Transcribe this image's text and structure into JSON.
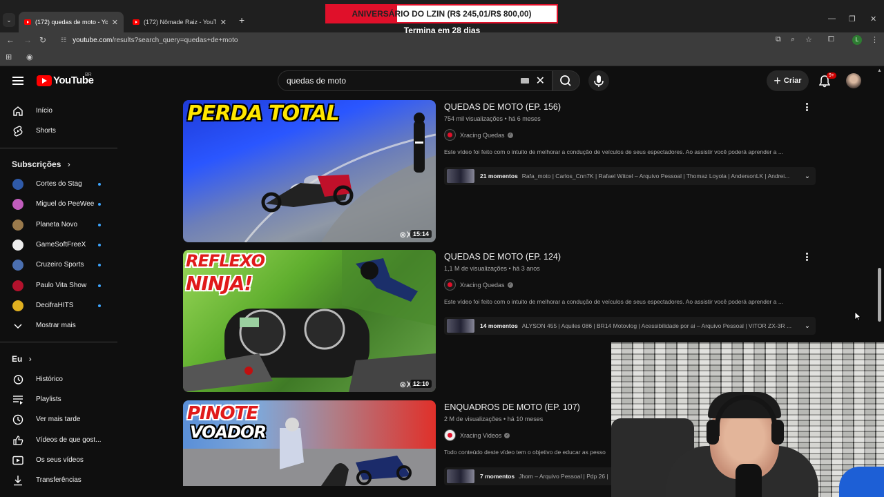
{
  "browser": {
    "tabs": [
      {
        "title": "(172) quedas de moto - YouTube",
        "active": true
      },
      {
        "title": "(172) Nômade Raiz - YouTube",
        "active": false
      }
    ],
    "url_host": "youtube.com",
    "url_path": "/results?search_query=quedas+de+moto",
    "profile_letter": "L"
  },
  "overlay": {
    "goal_text": "ANIVERSÁRIO DO LZIN (R$ 245,01/R$ 800,00)",
    "goal_progress_percent": 30.6,
    "countdown": "Termina em 28 dias",
    "fill_color": "#e0102a"
  },
  "header": {
    "logo": "YouTube",
    "country": "BR",
    "search_value": "quedas de moto",
    "create_label": "Criar",
    "notif_badge": "9+"
  },
  "sidebar": {
    "main": [
      {
        "label": "Início",
        "icon": "home-icon"
      },
      {
        "label": "Shorts",
        "icon": "shorts-icon"
      }
    ],
    "subscriptions_title": "Subscrições",
    "subscriptions": [
      {
        "label": "Cortes do Stag",
        "color": "#2f5aa8"
      },
      {
        "label": "Miguel do PeeWee",
        "color": "#c15dbd"
      },
      {
        "label": "Planeta Novo",
        "color": "#9a7a4c"
      },
      {
        "label": "GameSoftFreeX",
        "color": "#eeeeee"
      },
      {
        "label": "Cruzeiro Sports",
        "color": "#4b6fb0"
      },
      {
        "label": "Paulo Vita Show",
        "color": "#b3122d"
      },
      {
        "label": "DecifraHITS",
        "color": "#e0b020"
      }
    ],
    "show_more": "Mostrar mais",
    "you_title": "Eu",
    "you_items": [
      {
        "label": "Histórico",
        "icon": "history-icon"
      },
      {
        "label": "Playlists",
        "icon": "playlists-icon"
      },
      {
        "label": "Ver mais tarde",
        "icon": "watch-later-icon"
      },
      {
        "label": "Vídeos de que gost...",
        "icon": "like-icon"
      },
      {
        "label": "Os seus vídeos",
        "icon": "your-videos-icon"
      },
      {
        "label": "Transferências",
        "icon": "downloads-icon"
      }
    ]
  },
  "results": [
    {
      "title": "QUEDAS DE MOTO (EP. 156)",
      "views": "754 mil visualizações",
      "age": "há 6 meses",
      "channel": "Xracing Quedas",
      "description": "Este vídeo foi feito com o intuito de melhorar a condução de veículos de seus espectadores. Ao assistir você poderá aprender a ...",
      "moments_count": "21 momentos",
      "moments_list": "Rafa_moto | Carlos_Cnn7K | Rafael Witcel – Arquivo Pessoal | Thomaz Loyola | AndersonLK | Andrei...",
      "duration": "15:14",
      "thumb_text": "PERDA TOTAL"
    },
    {
      "title": "QUEDAS DE MOTO (EP. 124)",
      "views": "1,1 M de visualizações",
      "age": "há 3 anos",
      "channel": "Xracing Quedas",
      "description": "Este vídeo foi feito com o intuito de melhorar a condução de veículos de seus espectadores. Ao assistir você poderá aprender a ...",
      "moments_count": "14 momentos",
      "moments_list": "ALYSON 455 | Aquiles 086 | BR14 Motovlog | Acessibilidade por ai – Arquivo Pessoal | VITOR ZX-3R ...",
      "duration": "12:10",
      "thumb_text_1": "REFLEXO",
      "thumb_text_2": "NINJA!"
    },
    {
      "title": "ENQUADROS DE MOTO (EP. 107)",
      "views": "2 M de visualizações",
      "age": "há 10 meses",
      "channel": "Xracing Videos",
      "description": "Todo conteúdo deste vídeo tem o objetivo de educar as pesso",
      "moments_count": "7 momentos",
      "moments_list": "Jhom – Arquivo Pessoal | Pdp 26 |",
      "thumb_text_1": "PINOTE",
      "thumb_text_2": "VOADOR"
    }
  ]
}
